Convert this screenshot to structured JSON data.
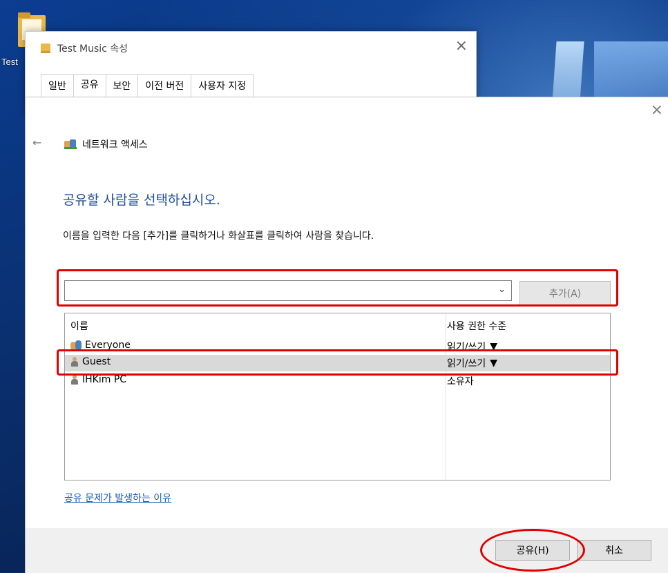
{
  "desktop": {
    "icon_label": "Test"
  },
  "props_window": {
    "title": "Test Music 속성",
    "tabs": [
      {
        "label": "일반"
      },
      {
        "label": "공유"
      },
      {
        "label": "보안"
      },
      {
        "label": "이전 버전"
      },
      {
        "label": "사용자 지정"
      }
    ],
    "active_tab": "공유"
  },
  "dialog": {
    "close_glyph": "×",
    "back_glyph": "←",
    "breadcrumb": "네트워크 액세스",
    "heading": "공유할 사람을 선택하십시오.",
    "instruction": "이름을 입력한 다음 [추가]를 클릭하거나 화살표를 클릭하여 사람을 찾습니다.",
    "name_input": {
      "value": "",
      "placeholder": ""
    },
    "add_button": "추가(A)",
    "columns": {
      "name": "이름",
      "permission": "사용 권한 수준"
    },
    "rows": [
      {
        "name": "Everyone",
        "permission": "읽기/쓰기",
        "has_dropdown": true,
        "icon": "group-icon"
      },
      {
        "name": "Guest",
        "permission": "읽기/쓰기",
        "has_dropdown": true,
        "icon": "user-icon",
        "selected": true
      },
      {
        "name": "IHKim PC",
        "permission": "소유자",
        "has_dropdown": false,
        "icon": "user-icon"
      }
    ],
    "help_link": "공유 문제가 발생하는 이유",
    "share_button": "공유(H)",
    "cancel_button": "취소"
  },
  "colors": {
    "heading": "#1f4e9a",
    "link": "#1a5fb4",
    "annotation": "#e00000",
    "selected_row": "#d9d9d9"
  }
}
